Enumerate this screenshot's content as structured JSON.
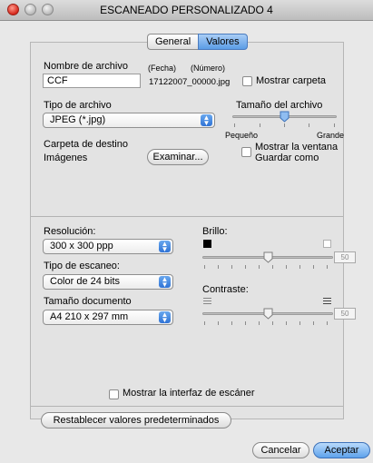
{
  "window": {
    "title": "ESCANEADO PERSONALIZADO 4"
  },
  "tabs": [
    {
      "label": "General"
    },
    {
      "label": "Valores"
    }
  ],
  "file": {
    "name_label": "Nombre de archivo",
    "date_label": "(Fecha)",
    "number_label": "(Número)",
    "name_value": "CCF",
    "generated_name": "17122007_00000.jpg",
    "show_folder_label": "Mostrar carpeta",
    "show_folder_checked": false
  },
  "file_type": {
    "label": "Tipo de archivo",
    "selected": "JPEG (*.jpg)"
  },
  "file_size": {
    "label": "Tamaño del archivo",
    "min_label": "Pequeño",
    "max_label": "Grande",
    "level_fraction": 0.5
  },
  "destination": {
    "label": "Carpeta de destino",
    "value": "Imágenes",
    "browse_label": "Examinar...",
    "show_saveas_label_line1": "Mostrar la ventana",
    "show_saveas_label_line2": "Guardar como",
    "show_saveas_checked": false
  },
  "resolution": {
    "label": "Resolución:",
    "selected": "300 x 300 ppp"
  },
  "scan_type": {
    "label": "Tipo de escaneo:",
    "selected": "Color de 24 bits"
  },
  "document_size": {
    "label": "Tamaño documento",
    "selected": "A4  210 x 297 mm"
  },
  "brightness": {
    "label": "Brillo:",
    "value": "50",
    "level_fraction": 0.5
  },
  "contrast": {
    "label": "Contraste:",
    "value": "50",
    "level_fraction": 0.5
  },
  "scanner_interface": {
    "label": "Mostrar la interfaz de escáner",
    "checked": false
  },
  "restore_defaults_label": "Restablecer valores predeterminados",
  "cancel_label": "Cancelar",
  "accept_label": "Aceptar"
}
